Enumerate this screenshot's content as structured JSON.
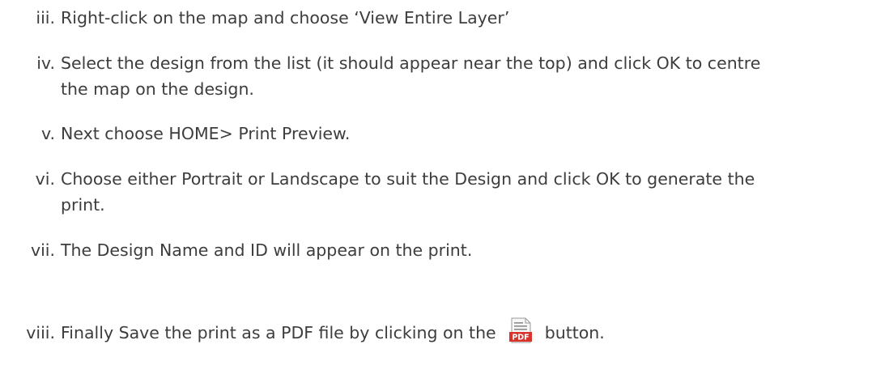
{
  "steps": [
    {
      "numeral": "iii.",
      "lines": [
        "Right-click on the map and choose ‘View Entire Layer’"
      ]
    },
    {
      "numeral": "iv.",
      "lines": [
        "Select the design from the list (it should appear near the top) and click OK to centre",
        "the map on the design."
      ]
    },
    {
      "numeral": "v.",
      "lines": [
        "Next choose HOME> Print Preview."
      ]
    },
    {
      "numeral": "vi.",
      "lines": [
        "Choose either Portrait or Landscape to suit the Design and click OK to generate the",
        "print."
      ]
    },
    {
      "numeral": "vii.",
      "lines": [
        "The Design Name and ID will appear on the print."
      ]
    },
    {
      "numeral": "viii.",
      "text_before": "Finally Save the print as a PDF file by clicking on the",
      "text_after": "button.",
      "icon": {
        "name": "pdf-icon",
        "label": "PDF",
        "colors": {
          "page": "#f7f7f7",
          "page_border": "#9a9a9a",
          "lines": "#8c8c8c",
          "badge": "#d9342b",
          "badge_text": "#ffffff"
        }
      }
    }
  ]
}
